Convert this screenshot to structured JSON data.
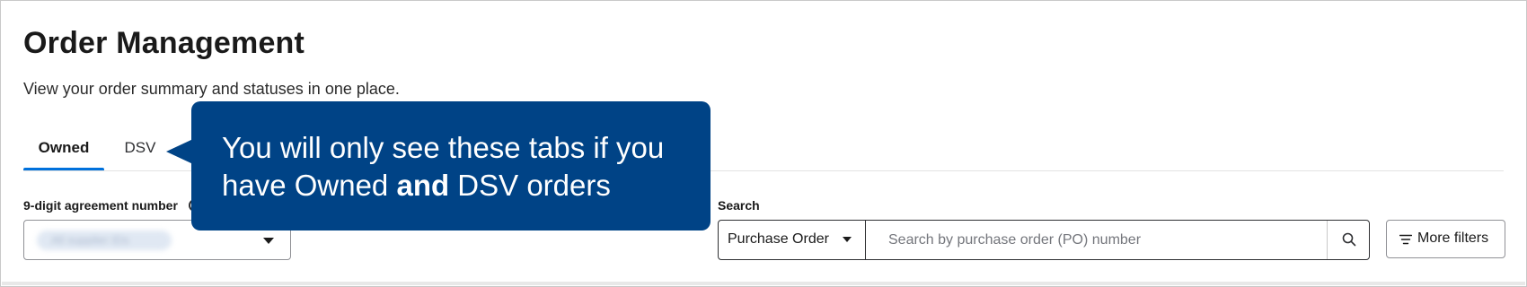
{
  "header": {
    "title": "Order Management",
    "subtitle": "View your order summary and statuses in one place."
  },
  "tabs": [
    {
      "label": "Owned",
      "active": true
    },
    {
      "label": "DSV",
      "active": false
    }
  ],
  "filters": {
    "agreement_label": "9-digit agreement number",
    "agreement_value": "All supplier IDs",
    "search_label": "Search",
    "search_type": "Purchase Order",
    "search_placeholder": "Search by purchase order (PO) number",
    "more_filters_label": "More filters"
  },
  "callout": {
    "text_part1": "You will only see these tabs if you have Owned ",
    "text_bold": "and",
    "text_part2": " DSV orders"
  },
  "colors": {
    "accent": "#0071dc",
    "callout_bg": "#004386"
  },
  "icons": [
    "info-icon",
    "chevron-down-icon",
    "search-icon",
    "filter-icon"
  ]
}
